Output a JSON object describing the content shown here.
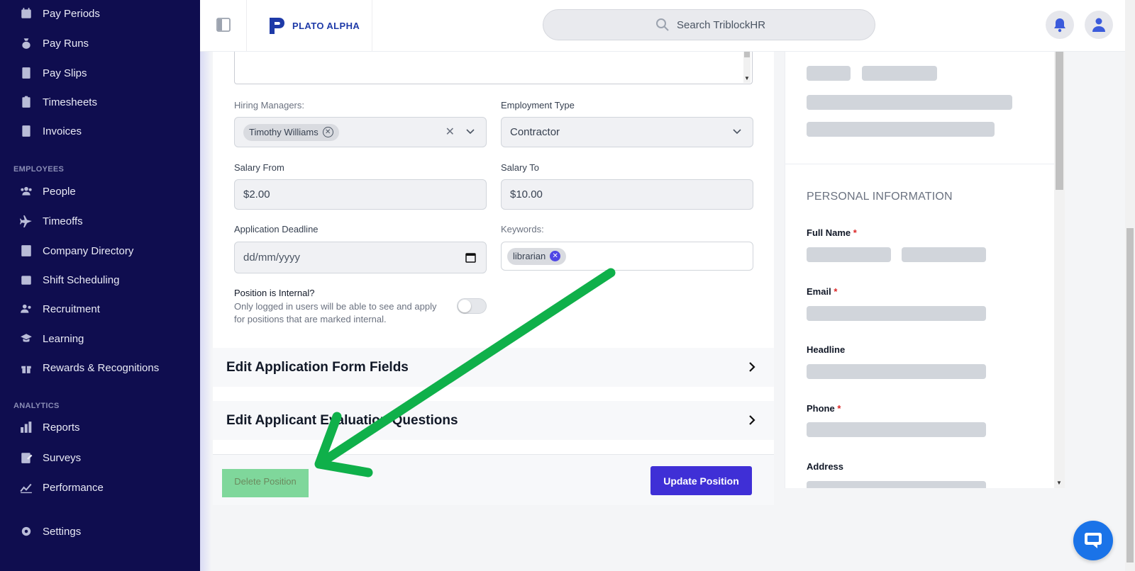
{
  "sidebar": {
    "items_top": [
      {
        "label": "Pay Periods",
        "icon": "calendar-icon"
      },
      {
        "label": "Pay Runs",
        "icon": "money-bag-icon"
      },
      {
        "label": "Pay Slips",
        "icon": "document-icon"
      },
      {
        "label": "Timesheets",
        "icon": "clipboard-icon"
      },
      {
        "label": "Invoices",
        "icon": "invoice-icon"
      }
    ],
    "employees_section": "EMPLOYEES",
    "items_employees": [
      {
        "label": "People",
        "icon": "people-icon"
      },
      {
        "label": "Timeoffs",
        "icon": "plane-icon"
      },
      {
        "label": "Company Directory",
        "icon": "directory-icon"
      },
      {
        "label": "Shift Scheduling",
        "icon": "calendar-icon"
      },
      {
        "label": "Recruitment",
        "icon": "recruitment-icon"
      },
      {
        "label": "Learning",
        "icon": "graduation-cap-icon"
      },
      {
        "label": "Rewards & Recognitions",
        "icon": "gift-icon"
      }
    ],
    "analytics_section": "ANALYTICS",
    "items_analytics": [
      {
        "label": "Reports",
        "icon": "bar-chart-icon"
      },
      {
        "label": "Surveys",
        "icon": "survey-icon"
      },
      {
        "label": "Performance",
        "icon": "trend-line-icon"
      }
    ],
    "settings_label": "Settings"
  },
  "header": {
    "logo_text": "PLATO ALPHA",
    "search_placeholder": "Search TriblockHR"
  },
  "form": {
    "hiring_managers_label": "Hiring Managers:",
    "hiring_manager_chip": "Timothy Williams",
    "employment_type_label": "Employment Type",
    "employment_type_value": "Contractor",
    "salary_from_label": "Salary From",
    "salary_from_value": "$2.00",
    "salary_to_label": "Salary To",
    "salary_to_value": "$10.00",
    "deadline_label": "Application Deadline",
    "deadline_placeholder": "dd/mm/yyyy",
    "keywords_label": "Keywords:",
    "keyword_chip": "librarian",
    "internal_label": "Position is Internal?",
    "internal_help_line1": "Only logged in users will be able to see and apply",
    "internal_help_line2": "for positions that are marked internal.",
    "internal_enabled": false,
    "accordion_form_fields": "Edit Application Form Fields",
    "accordion_eval_questions": "Edit Applicant Evaluation Questions",
    "delete_label": "Delete Position",
    "update_label": "Update Position"
  },
  "right_panel": {
    "section_title": "PERSONAL INFORMATION",
    "full_name_label": "Full Name",
    "email_label": "Email",
    "headline_label": "Headline",
    "phone_label": "Phone",
    "address_label": "Address",
    "required_mark": "*"
  },
  "colors": {
    "sidebar_bg": "#0f0d4f",
    "primary_button": "#3f2fd6",
    "delete_highlight": "#7fd79b",
    "annotation_arrow": "#0fb04a",
    "chat_button": "#1a73e8"
  }
}
